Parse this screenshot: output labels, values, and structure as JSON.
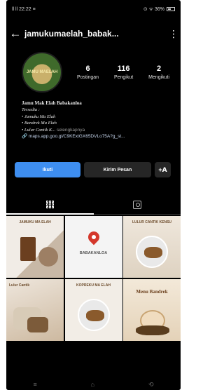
{
  "status_bar": {
    "left": "ll ll 22:22 ≡",
    "right": "⊙ ᯤ 36%"
  },
  "header": {
    "back_icon": "arrow-left-icon",
    "username": "jamukumaelah_babak...",
    "more_icon": "kebab-icon"
  },
  "profile": {
    "avatar_text": "JAMU MAELAH",
    "stats": [
      {
        "value": "6",
        "label": "Postingan"
      },
      {
        "value": "116",
        "label": "Pengikut"
      },
      {
        "value": "2",
        "label": "Mengikuti"
      }
    ],
    "bio": {
      "name": "Jamu Mak Elah Babakanloa",
      "line1": "Tersedia :",
      "line2": "• Jamuku Ma Elah",
      "line3": "• Bandrek Ma Elah",
      "line4_prefix": "• Lulur Cantik K...",
      "line4_suffix": " selengkapnya",
      "link": "maps.app.goo.gl/C9KExtGX65DVLo75A?g_st..."
    }
  },
  "actions": {
    "follow_label": "Ikuti",
    "message_label": "Kirim Pesan",
    "add_icon": "add-person-icon"
  },
  "tabs": [
    {
      "icon": "grid-icon",
      "active": true
    },
    {
      "icon": "tagged-icon",
      "active": false
    }
  ],
  "posts": {
    "p1_title": "JAMUKU MA ELAH",
    "p2_text": "BABAKANLOA",
    "p3_title": "LULUR CANTIK KENSU",
    "p4_title": "Lulur Cantik",
    "p5_title": "KOPREKU MA ELAH",
    "p6_title": "Menu Bandrek"
  },
  "navbar": {
    "menu": "≡",
    "home": "⌂",
    "back": "⟲"
  }
}
